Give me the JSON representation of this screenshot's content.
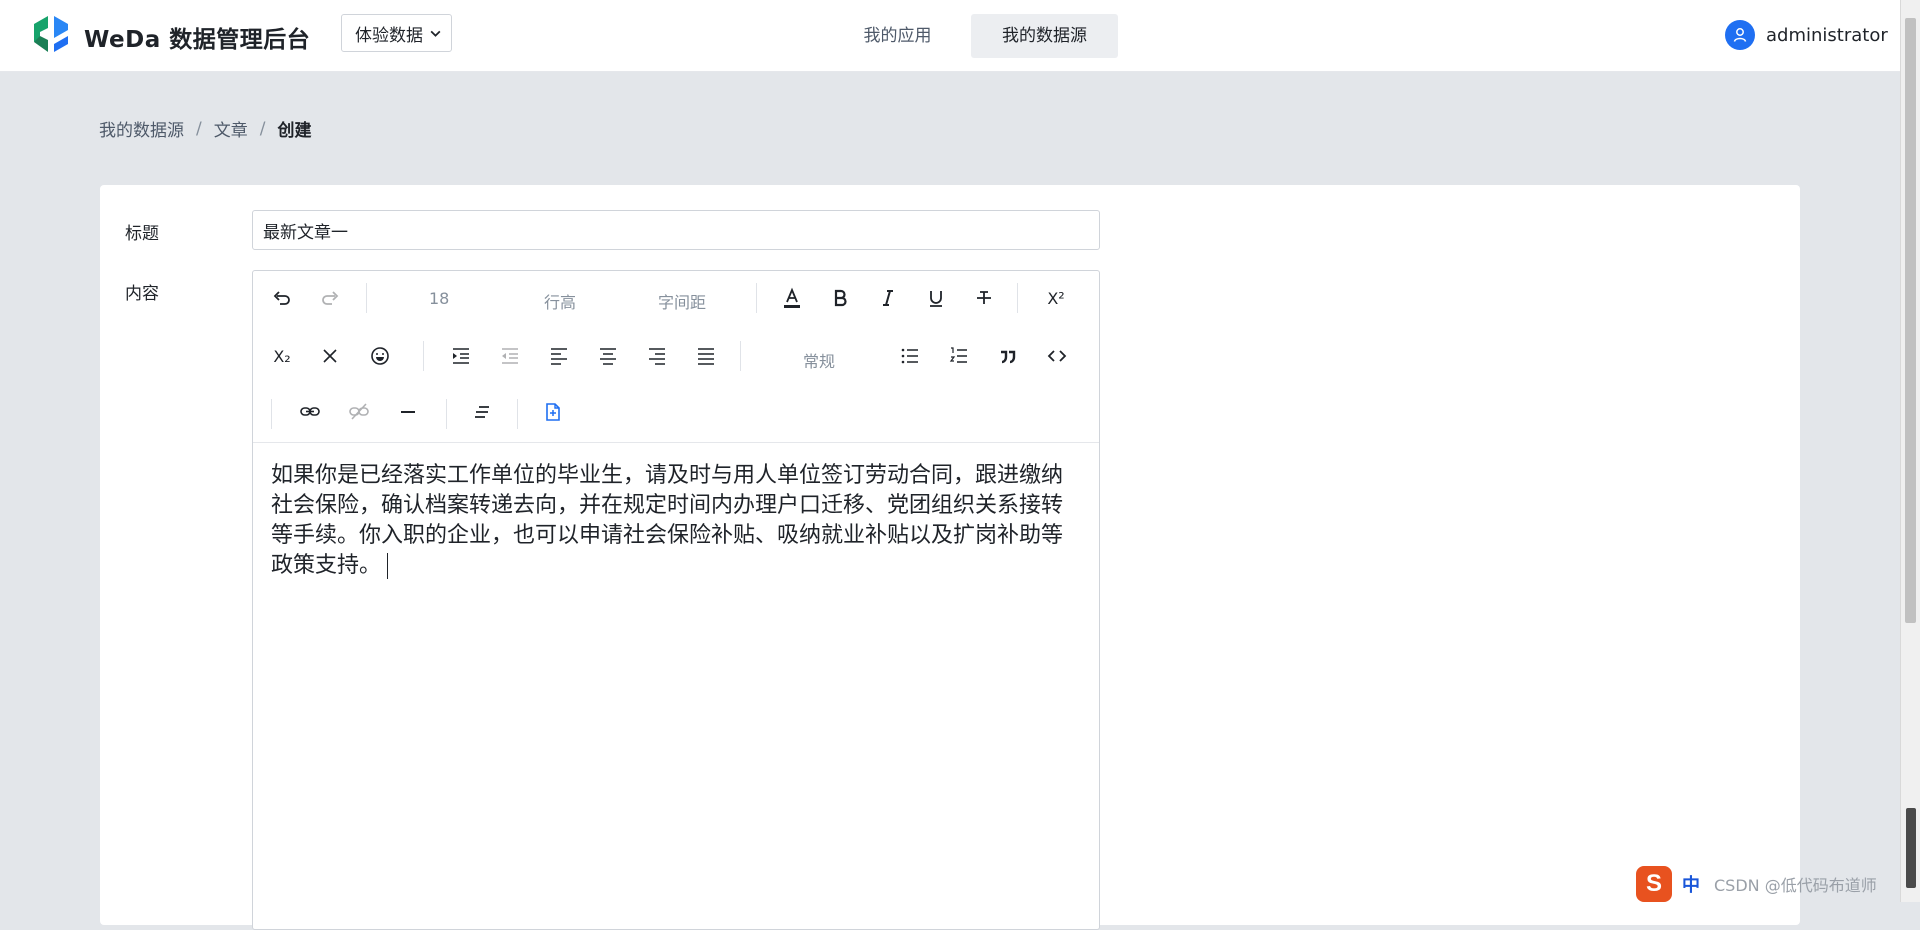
{
  "header": {
    "brand": "WeDa 数据管理后台",
    "env_select": "体验数据",
    "nav": [
      {
        "label": "我的应用",
        "active": false
      },
      {
        "label": "我的数据源",
        "active": true
      }
    ],
    "user": "administrator"
  },
  "breadcrumb": [
    "我的数据源",
    "文章",
    "创建"
  ],
  "form": {
    "title_label": "标题",
    "title_value": "最新文章一",
    "content_label": "内容",
    "content_text": "如果你是已经落实工作单位的毕业生，请及时与用人单位签订劳动合同，跟进缴纳社会保险，确认档案转递去向，并在规定时间内办理户口迁移、党团组织关系接转等手续。你入职的企业，也可以申请社会保险补贴、吸纳就业补贴以及扩岗补助等政策支持。"
  },
  "toolbar": {
    "font_size": "18",
    "line_height": "行高",
    "letter_spacing": "字间距",
    "heading": "常规",
    "superscript": "X²",
    "subscript": "X₂"
  },
  "ime": {
    "logo": "S",
    "mode": "中",
    "watermark": "CSDN @低代码布道师"
  },
  "colors": {
    "accent": "#1f6ff2",
    "page_bg": "#e3e6ea"
  }
}
